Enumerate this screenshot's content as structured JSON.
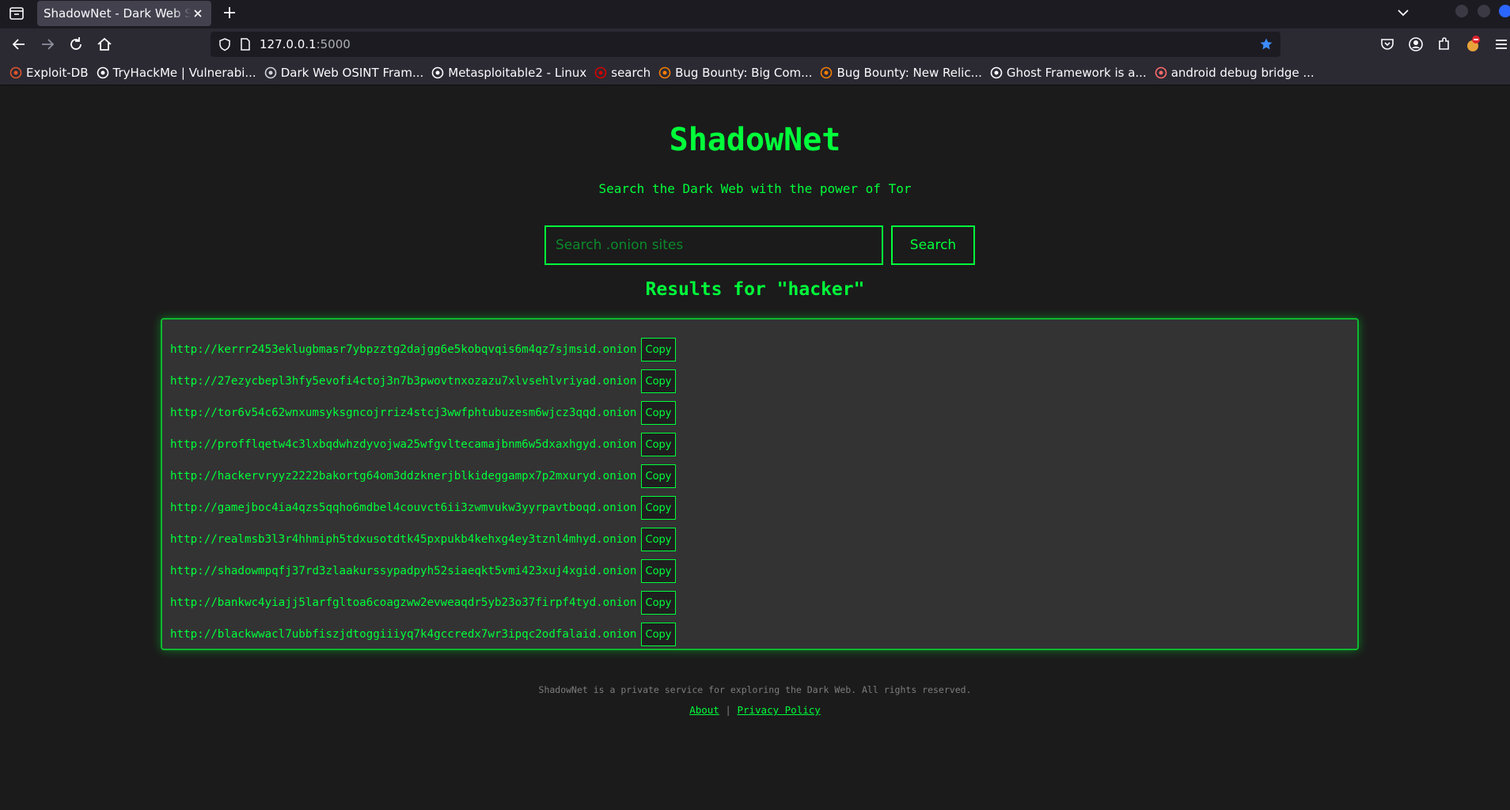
{
  "browser": {
    "tab_title": "ShadowNet - Dark Web Sear",
    "url_host": "127.0.0.1",
    "url_port": ":5000",
    "bookmarks": [
      {
        "label": "Exploit-DB",
        "icon": "exploit-db-icon",
        "color": "#e2552c"
      },
      {
        "label": "TryHackMe | Vulnerabi...",
        "icon": "tryhackme-icon",
        "color": "#ffffff"
      },
      {
        "label": "Dark Web OSINT Fram...",
        "icon": "terminal-icon",
        "color": "#cfd2dc"
      },
      {
        "label": "Metasploitable2 - Linux",
        "icon": "globe-icon",
        "color": "#fbfbfe"
      },
      {
        "label": "search",
        "icon": "search-site-icon",
        "color": "#d70000"
      },
      {
        "label": "Bug Bounty: Big Com...",
        "icon": "blogger-icon",
        "color": "#f57d00"
      },
      {
        "label": "Bug Bounty: New Relic...",
        "icon": "blogger-icon",
        "color": "#f57d00"
      },
      {
        "label": "Ghost Framework is a...",
        "icon": "github-icon",
        "color": "#fbfbfe"
      },
      {
        "label": "android debug bridge ...",
        "icon": "android-icon",
        "color": "#ff6b6b"
      }
    ]
  },
  "site": {
    "title": "ShadowNet",
    "tagline": "Search the Dark Web with the power of Tor",
    "search_placeholder": "Search .onion sites",
    "search_button": "Search",
    "results_title": "Results for \"hacker\"",
    "copy_label": "Copy",
    "results": [
      "http://kerrr2453eklugbmasr7ybpzztg2dajgg6e5kobqvqis6m4qz7sjmsid.onion",
      "http://27ezycbepl3hfy5evofi4ctoj3n7b3pwovtnxozazu7xlvsehlvriyad.onion",
      "http://tor6v54c62wnxumsyksgncojrriz4stcj3wwfphtubuzesm6wjcz3qqd.onion",
      "http://profflqetw4c3lxbqdwhzdyvojwa25wfgvltecamajbnm6w5dxaxhgyd.onion",
      "http://hackervryyz2222bakortg64om3ddzknerjblkideggampx7p2mxuryd.onion",
      "http://gamejboc4ia4qzs5qqho6mdbel4couvct6ii3zwmvukw3yyrpavtboqd.onion",
      "http://realmsb3l3r4hhmiph5tdxusotdtk45pxpukb4kehxg4ey3tznl4mhyd.onion",
      "http://shadowmpqfj37rd3zlaakurssypadpyh52siaeqkt5vmi423xuj4xgid.onion",
      "http://bankwc4yiajj5larfgltoa6coagzww2evweaqdr5yb23o37firpf4tyd.onion",
      "http://blackwwacl7ubbfiszjdtoggiiiyq7k4gccredx7wr3ipqc2odfalaid.onion"
    ],
    "footer_text": "ShadowNet is a private service for exploring the Dark Web. All rights reserved.",
    "footer_about": "About",
    "footer_separator": "|",
    "footer_privacy": "Privacy Policy"
  },
  "colors": {
    "accent_green": "#00ff3a",
    "page_bg": "#1b1b1b",
    "panel_bg": "#333333"
  }
}
